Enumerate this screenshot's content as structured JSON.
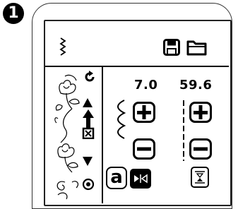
{
  "step_badge": "1",
  "header": {
    "save_icon": "floppy-disk-icon",
    "folder_icon": "folder-icon",
    "stitch_icon": "zigzag-stitch-icon"
  },
  "pattern_panel": {
    "rotate_icon": "rotate-icon",
    "scroll_up_icon": "arrow-up-icon",
    "scroll_down_icon": "arrow-down-icon",
    "close_icon": "close-box-icon",
    "target_icon": "target-circle-icon"
  },
  "stitch_width": {
    "value": "7.0",
    "plus_icon": "plus-icon",
    "minus_icon": "minus-icon"
  },
  "stitch_length": {
    "value": "59.6",
    "plus_icon": "plus-icon",
    "minus_icon": "minus-icon"
  },
  "bottom": {
    "text_mode_label": "a",
    "mirror_icon": "mirror-icon",
    "needle_icon": "needle-position-icon"
  }
}
